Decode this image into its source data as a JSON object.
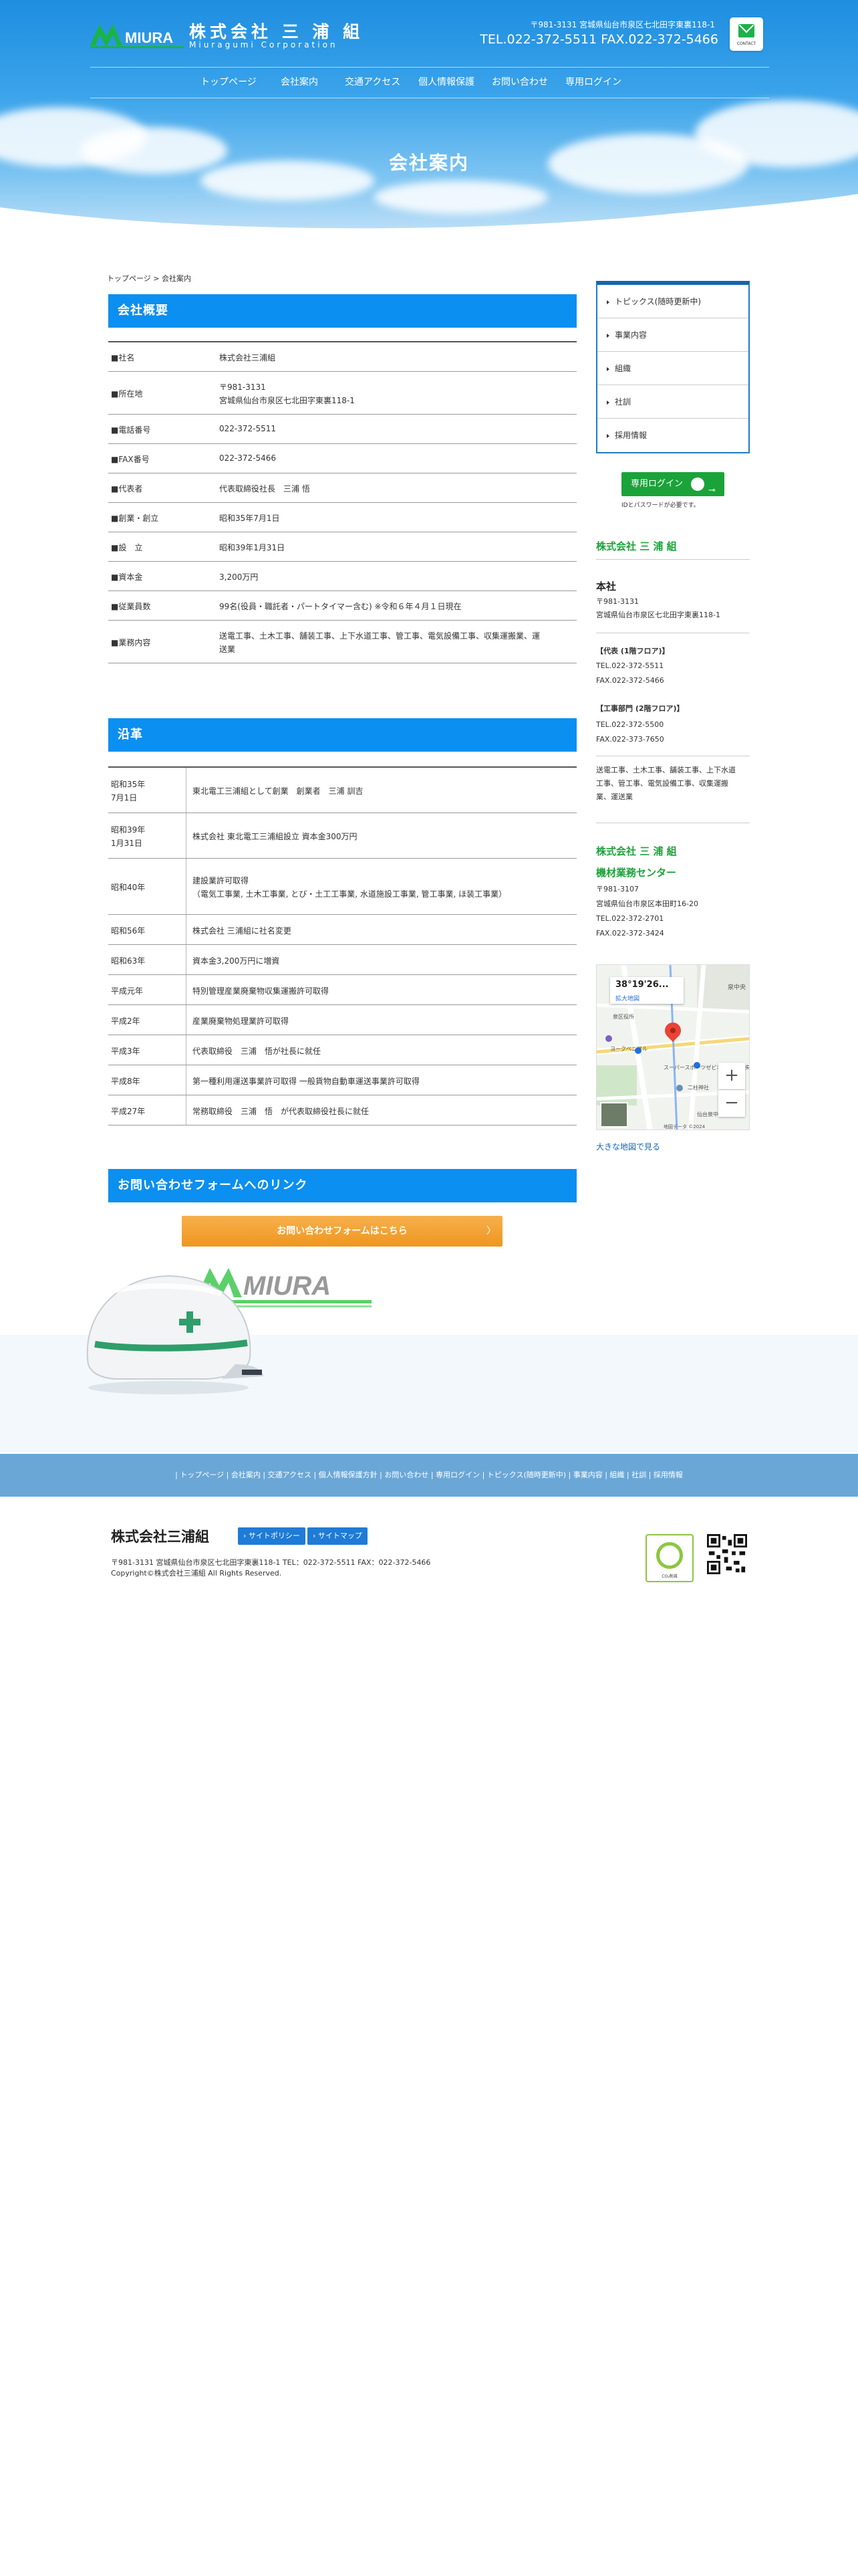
{
  "header": {
    "company_name": "株式会社 三 浦 組",
    "company_en": "Miuragumi Corporation",
    "logo_text": "MIURA",
    "address": "〒981-3131 宮城県仙台市泉区七北田字東裏118-1",
    "tel": "TEL.022-372-5511 FAX.022-372-5466",
    "mail_label": "CONTACT"
  },
  "nav": [
    "トップページ",
    "会社案内",
    "交通アクセス",
    "個人情報保護",
    "お問い合わせ",
    "専用ログイン"
  ],
  "page_title": "会社案内",
  "breadcrumb": "トップページ > 会社案内",
  "overview": {
    "heading": "会社概要",
    "rows": [
      {
        "k": "■社名",
        "v": "株式会社三浦組"
      },
      {
        "k": "■所在地",
        "v": "〒981-3131",
        "v2": "宮城県仙台市泉区七北田字東裏118-1"
      },
      {
        "k": "■電話番号",
        "v": "022-372-5511"
      },
      {
        "k": "■FAX番号",
        "v": "022-372-5466"
      },
      {
        "k": "■代表者",
        "v": "代表取締役社長　三浦 悟"
      },
      {
        "k": "■創業・創立",
        "v": "昭和35年7月1日"
      },
      {
        "k": "■設　立",
        "v": "昭和39年1月31日"
      },
      {
        "k": "■資本金",
        "v": "3,200万円"
      },
      {
        "k": "■従業員数",
        "v": "99名(役員・職託者・パートタイマー含む) ※令和６年４月１日現在"
      },
      {
        "k": "■業務内容",
        "v": "送電工事、土木工事、舗装工事、上下水道工事、管工事、電気設備工事、収集運搬業、運",
        "v2": "送業"
      }
    ]
  },
  "history": {
    "heading": "沿革",
    "rows": [
      {
        "k": "昭和35年",
        "k2": "7月1日",
        "v": "東北電工三浦組として創業　創業者　三浦 訓吉"
      },
      {
        "k": "昭和39年",
        "k2": "1月31日",
        "v": "株式会社 東北電工三浦組設立 資本金300万円"
      },
      {
        "k": "昭和40年",
        "v": "建設業許可取得",
        "v2": "（電気工事業, 土木工事業, とび・土工工事業, 水道施設工事業, 管工事業, ほ装工事業）"
      },
      {
        "k": "昭和56年",
        "v": "株式会社 三浦組に社名変更"
      },
      {
        "k": "昭和63年",
        "v": "資本金3,200万円に増資"
      },
      {
        "k": "平成元年",
        "v": "特別管理産業廃棄物収集運搬許可取得"
      },
      {
        "k": "平成2年",
        "v": "産業廃棄物処理業許可取得"
      },
      {
        "k": "平成3年",
        "v": "代表取締役　三浦　悟が社長に就任"
      },
      {
        "k": "平成8年",
        "v": "第一種利用運送事業許可取得 一般貨物自動車運送事業許可取得"
      },
      {
        "k": "平成27年",
        "v": "常務取締役　三浦　悟　が代表取締役社長に就任"
      }
    ]
  },
  "contact": {
    "heading": "お問い合わせフォームへのリンク",
    "button": "お問い合わせフォームはこちら",
    "arrow": "〉"
  },
  "side_menu": [
    "トピックス(随時更新中)",
    "事業内容",
    "組織",
    "社訓",
    "採用情報"
  ],
  "login": {
    "label": "専用ログイン",
    "key": "⊸",
    "note": "IDとパスワードが必要です。"
  },
  "sidebar": {
    "company": "株式会社 三 浦 組",
    "hq_title": "本社",
    "hq_zip": "〒981-3131",
    "hq_address": "宮城県仙台市泉区七北田字東裏118-1",
    "rep_label": "【代表 (1階フロア)】",
    "rep_tel": "TEL.022-372-5511",
    "rep_fax": "FAX.022-372-5466",
    "work_label": "【工事部門 (2階フロア)】",
    "work_tel": "TEL.022-372-5500",
    "work_fax": "FAX.022-373-7650",
    "services_1": "送電工事、土木工事、舗装工事、上下水道",
    "services_2": "工事、管工事、電気設備工事、収集運搬",
    "services_3": "業、運送業",
    "company2": "株式会社 三 浦 組",
    "center": "機材業務センター",
    "center_zip": "〒981-3107",
    "center_address": "宮城県仙台市泉区本田町16-20",
    "center_tel": "TEL.022-372-2701",
    "center_fax": "FAX.022-372-3424"
  },
  "map": {
    "coord": "38°19'26...",
    "sub": "拡大地図",
    "zoom_in": "+",
    "zoom_out": "−",
    "label_1": "泉区役所",
    "label_2": "ヨークベニマル",
    "label_3": "二柱神社",
    "label_4": "スーパースポーツゼビオ 仙台泉中央店",
    "label_5": "仙台泉中",
    "label_6": "泉中央",
    "label_7": "地図データ ©2024",
    "link": "大きな地図で見る"
  },
  "footer": {
    "nav": "| トップページ | 会社案内 | 交通アクセス | 個人情報保護方針 | お問い合わせ | 専用ログイン | トピックス(随時更新中) | 事業内容 | 組織 | 社訓 | 採用情報",
    "name": "株式会社三浦組",
    "policy_btn": "› サイトポリシー",
    "sitemap_btn": "› サイトマップ",
    "address": "〒981-3131 宮城県仙台市泉区七北田字東裏118-1 TEL：022-372-5511 FAX：022-372-5466",
    "copyright": "Copyright©株式会社三浦組 All Rights Reserved.",
    "badge": "CO₂削減"
  },
  "colors": {
    "blue": "#0b8ff0",
    "green": "#1ba339",
    "orange": "#ef9620"
  }
}
